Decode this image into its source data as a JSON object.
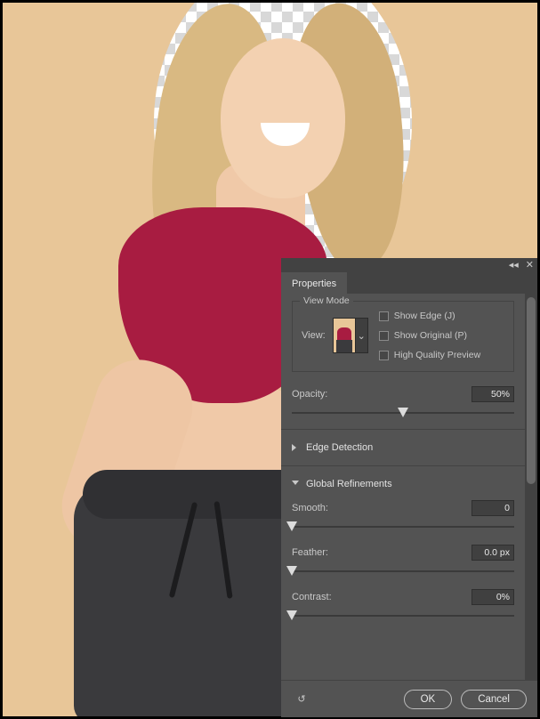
{
  "panel": {
    "tab": "Properties",
    "view_mode": {
      "legend": "View Mode",
      "view_label": "View:",
      "show_edge": "Show Edge (J)",
      "show_original": "Show Original (P)",
      "high_quality": "High Quality Preview"
    },
    "opacity": {
      "label": "Opacity:",
      "value": "50%",
      "pct": 50
    },
    "edge_detection": {
      "label": "Edge Detection"
    },
    "global_refinements": {
      "label": "Global Refinements",
      "smooth": {
        "label": "Smooth:",
        "value": "0",
        "pct": 0
      },
      "feather": {
        "label": "Feather:",
        "value": "0.0 px",
        "pct": 0
      },
      "contrast": {
        "label": "Contrast:",
        "value": "0%",
        "pct": 0
      }
    },
    "footer": {
      "ok": "OK",
      "cancel": "Cancel"
    }
  },
  "icons": {
    "collapse": "◂◂",
    "close": "✕",
    "chevron": "⌄",
    "reset": "↺"
  }
}
